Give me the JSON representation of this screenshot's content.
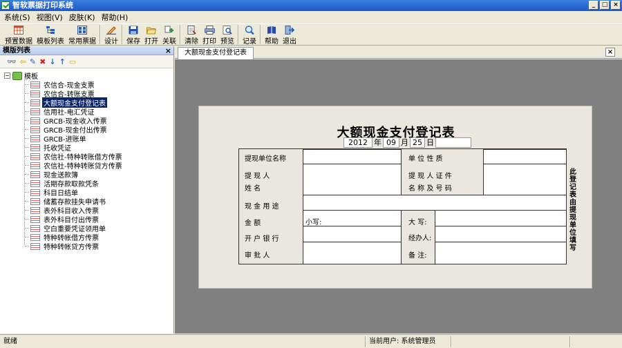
{
  "window": {
    "title": "智软票据打印系统"
  },
  "menu": [
    "系统(S)",
    "视图(V)",
    "皮肤(K)",
    "帮助(H)"
  ],
  "toolbar": {
    "buttons": [
      {
        "label": "预置数据",
        "icon": "grid-table-icon",
        "color": "#c8502a"
      },
      {
        "label": "模板列表",
        "icon": "tree-list-icon",
        "color": "#2a5cb8"
      },
      {
        "label": "常用票据",
        "icon": "ticket-grid-icon",
        "color": "#2a5cb8"
      },
      {
        "label": "设计",
        "icon": "design-pencil-icon",
        "color": "#b83a2a"
      },
      {
        "label": "保存",
        "icon": "save-disk-icon",
        "color": "#1e4ea8"
      },
      {
        "label": "打开",
        "icon": "open-folder-icon",
        "color": "#e0b030"
      },
      {
        "label": "关联",
        "icon": "link-icon",
        "color": "#2a9a3a"
      },
      {
        "label": "清除",
        "icon": "clear-page-icon",
        "color": "#555555"
      },
      {
        "label": "打印",
        "icon": "printer-icon",
        "color": "#4a6ab0"
      },
      {
        "label": "预览",
        "icon": "preview-icon",
        "color": "#777777"
      },
      {
        "label": "记录",
        "icon": "search-record-icon",
        "color": "#2a6ab8"
      },
      {
        "label": "帮助",
        "icon": "help-book-icon",
        "color": "#2a4aa8"
      },
      {
        "label": "退出",
        "icon": "exit-door-icon",
        "color": "#1e5ab8"
      }
    ]
  },
  "left_panel": {
    "title": "模版列表",
    "close": "×",
    "tools": [
      "binoculars-icon",
      "back-icon",
      "edit-icon",
      "delete-icon",
      "move-down-icon",
      "move-up-icon",
      "folder-icon"
    ],
    "root_label": "模板",
    "items": [
      "农信合-现金支票",
      "农信合-转账支票",
      "大额现金支付登记表",
      "信用社-电汇凭证",
      "GRCB-现金收入传票",
      "GRCB-现金付出传票",
      "GRCB-进账单",
      "托收凭证",
      "农信社-特种转账借方传票",
      "农信社-特种转账贷方传票",
      "现金送款簿",
      "活期存款取款凭条",
      "科目日结单",
      "储蓄存款挂失申请书",
      "表外科目收入传票",
      "表外科目付出传票",
      "空白重要凭证领用单",
      "特种转帐借方传票",
      "特种转帐贷方传票"
    ],
    "selected_index": 2
  },
  "tab": {
    "label": "大额现金支付登记表",
    "close": "×"
  },
  "form": {
    "title": "大额现金支付登记表",
    "date": {
      "year": "2012",
      "year_unit": "年",
      "month": "09",
      "month_unit": "月",
      "day": "25",
      "day_unit": "日"
    },
    "labels": {
      "withdraw_unit": "提现单位名称",
      "unit_nature": "单 位 性 质",
      "person1": "提 现 人",
      "person2": "姓 名",
      "id1": "提 现 人 证 件",
      "id2": "名 称 及 号 码",
      "purpose": "现 金 用 途",
      "amount": "金 额",
      "small": "小写:",
      "big": "大 写:",
      "bank": "开 户 银 行",
      "handler": "经办人:",
      "approver": "审 批 人",
      "remark": "备 注:"
    },
    "side_note": "此登记表由提现单位填写"
  },
  "status": {
    "left": "就绪",
    "user": "当前用户: 系统管理员"
  }
}
